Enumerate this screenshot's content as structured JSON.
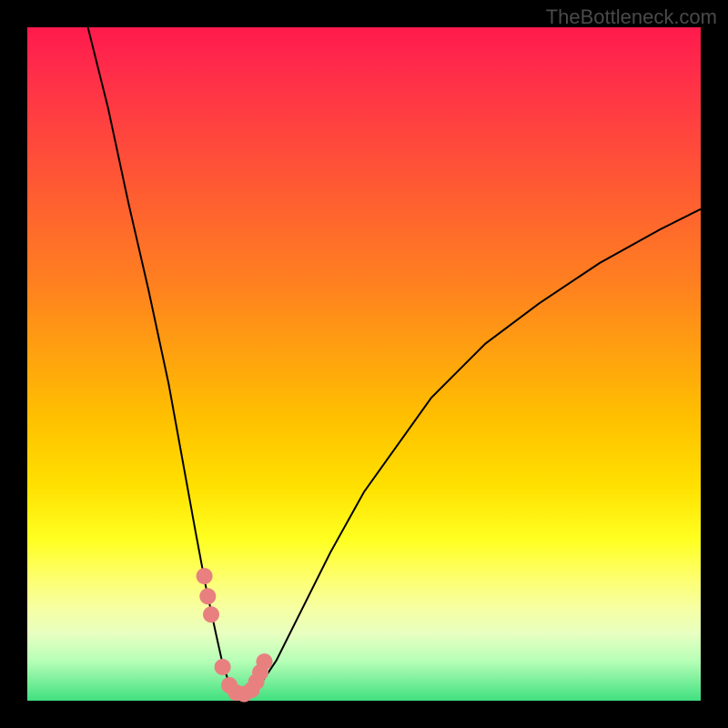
{
  "credit": "TheBottleneck.com",
  "chart_data": {
    "type": "line",
    "title": "",
    "xlabel": "",
    "ylabel": "",
    "xlim": [
      0,
      100
    ],
    "ylim": [
      0,
      100
    ],
    "series": [
      {
        "name": "bottleneck-curve",
        "x": [
          9,
          12,
          15,
          18,
          21,
          23,
          25,
          26.5,
          28,
          29,
          30,
          31,
          32,
          33,
          35,
          37,
          40,
          45,
          50,
          55,
          60,
          68,
          76,
          85,
          94,
          100
        ],
        "y": [
          100,
          88,
          74,
          61,
          47,
          36,
          25,
          17,
          10,
          5.5,
          2.5,
          1.2,
          1,
          1.4,
          3,
          6,
          12,
          22,
          31,
          38,
          45,
          53,
          59,
          65,
          70,
          73
        ]
      }
    ],
    "markers": {
      "name": "highlight-dots",
      "x": [
        26.3,
        26.8,
        27.3,
        29.0,
        30.0,
        31.0,
        32.2,
        33.3,
        34.0,
        34.6,
        35.2
      ],
      "y": [
        18.5,
        15.5,
        12.8,
        5.0,
        2.3,
        1.2,
        1.0,
        1.6,
        2.8,
        4.2,
        5.8
      ]
    }
  }
}
